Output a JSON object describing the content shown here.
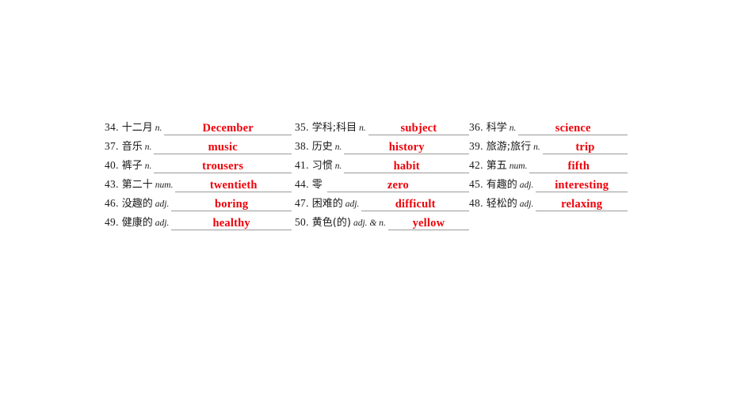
{
  "page": {
    "background_color": "#ffffff",
    "answer_color": "#ee0008",
    "rule_color": "#9a9a9a",
    "text_color": "#1a1a1a",
    "type": "vocabulary-fill-in-the-blank-worksheet"
  },
  "columns": [
    {
      "entries": [
        {
          "number": "34.",
          "chinese": "十二月",
          "pos": "n.",
          "answer": "December"
        },
        {
          "number": "37.",
          "chinese": "音乐",
          "pos": "n.",
          "answer": "music"
        },
        {
          "number": "40.",
          "chinese": "裤子",
          "pos": "n.",
          "answer": "trousers"
        },
        {
          "number": "43.",
          "chinese": "第二十",
          "pos": "num.",
          "answer": "twentieth"
        },
        {
          "number": "46.",
          "chinese": "没趣的",
          "pos": "adj.",
          "answer": "boring"
        },
        {
          "number": "49.",
          "chinese": "健康的",
          "pos": "adj.",
          "answer": "healthy"
        }
      ]
    },
    {
      "entries": [
        {
          "number": "35.",
          "chinese": "学科;科目",
          "pos": "n.",
          "answer": "subject"
        },
        {
          "number": "38.",
          "chinese": "历史",
          "pos": "n.",
          "answer": "history"
        },
        {
          "number": "41.",
          "chinese": "习惯",
          "pos": "n.",
          "answer": "habit"
        },
        {
          "number": "44.",
          "chinese": "零",
          "pos": "",
          "answer": "zero"
        },
        {
          "number": "47.",
          "chinese": "困难的",
          "pos": "adj.",
          "answer": "difficult"
        },
        {
          "number": "50.",
          "chinese": "黄色(的)",
          "pos": "adj. & n.",
          "answer": "yellow"
        }
      ]
    },
    {
      "entries": [
        {
          "number": "36.",
          "chinese": "科学",
          "pos": "n.",
          "answer": "science"
        },
        {
          "number": "39.",
          "chinese": "旅游;旅行",
          "pos": "n.",
          "answer": "trip"
        },
        {
          "number": "42.",
          "chinese": "第五",
          "pos": "num.",
          "answer": "fifth"
        },
        {
          "number": "45.",
          "chinese": "有趣的",
          "pos": "adj.",
          "answer": "interesting"
        },
        {
          "number": "48.",
          "chinese": "轻松的",
          "pos": "adj.",
          "answer": "relaxing"
        }
      ]
    }
  ]
}
